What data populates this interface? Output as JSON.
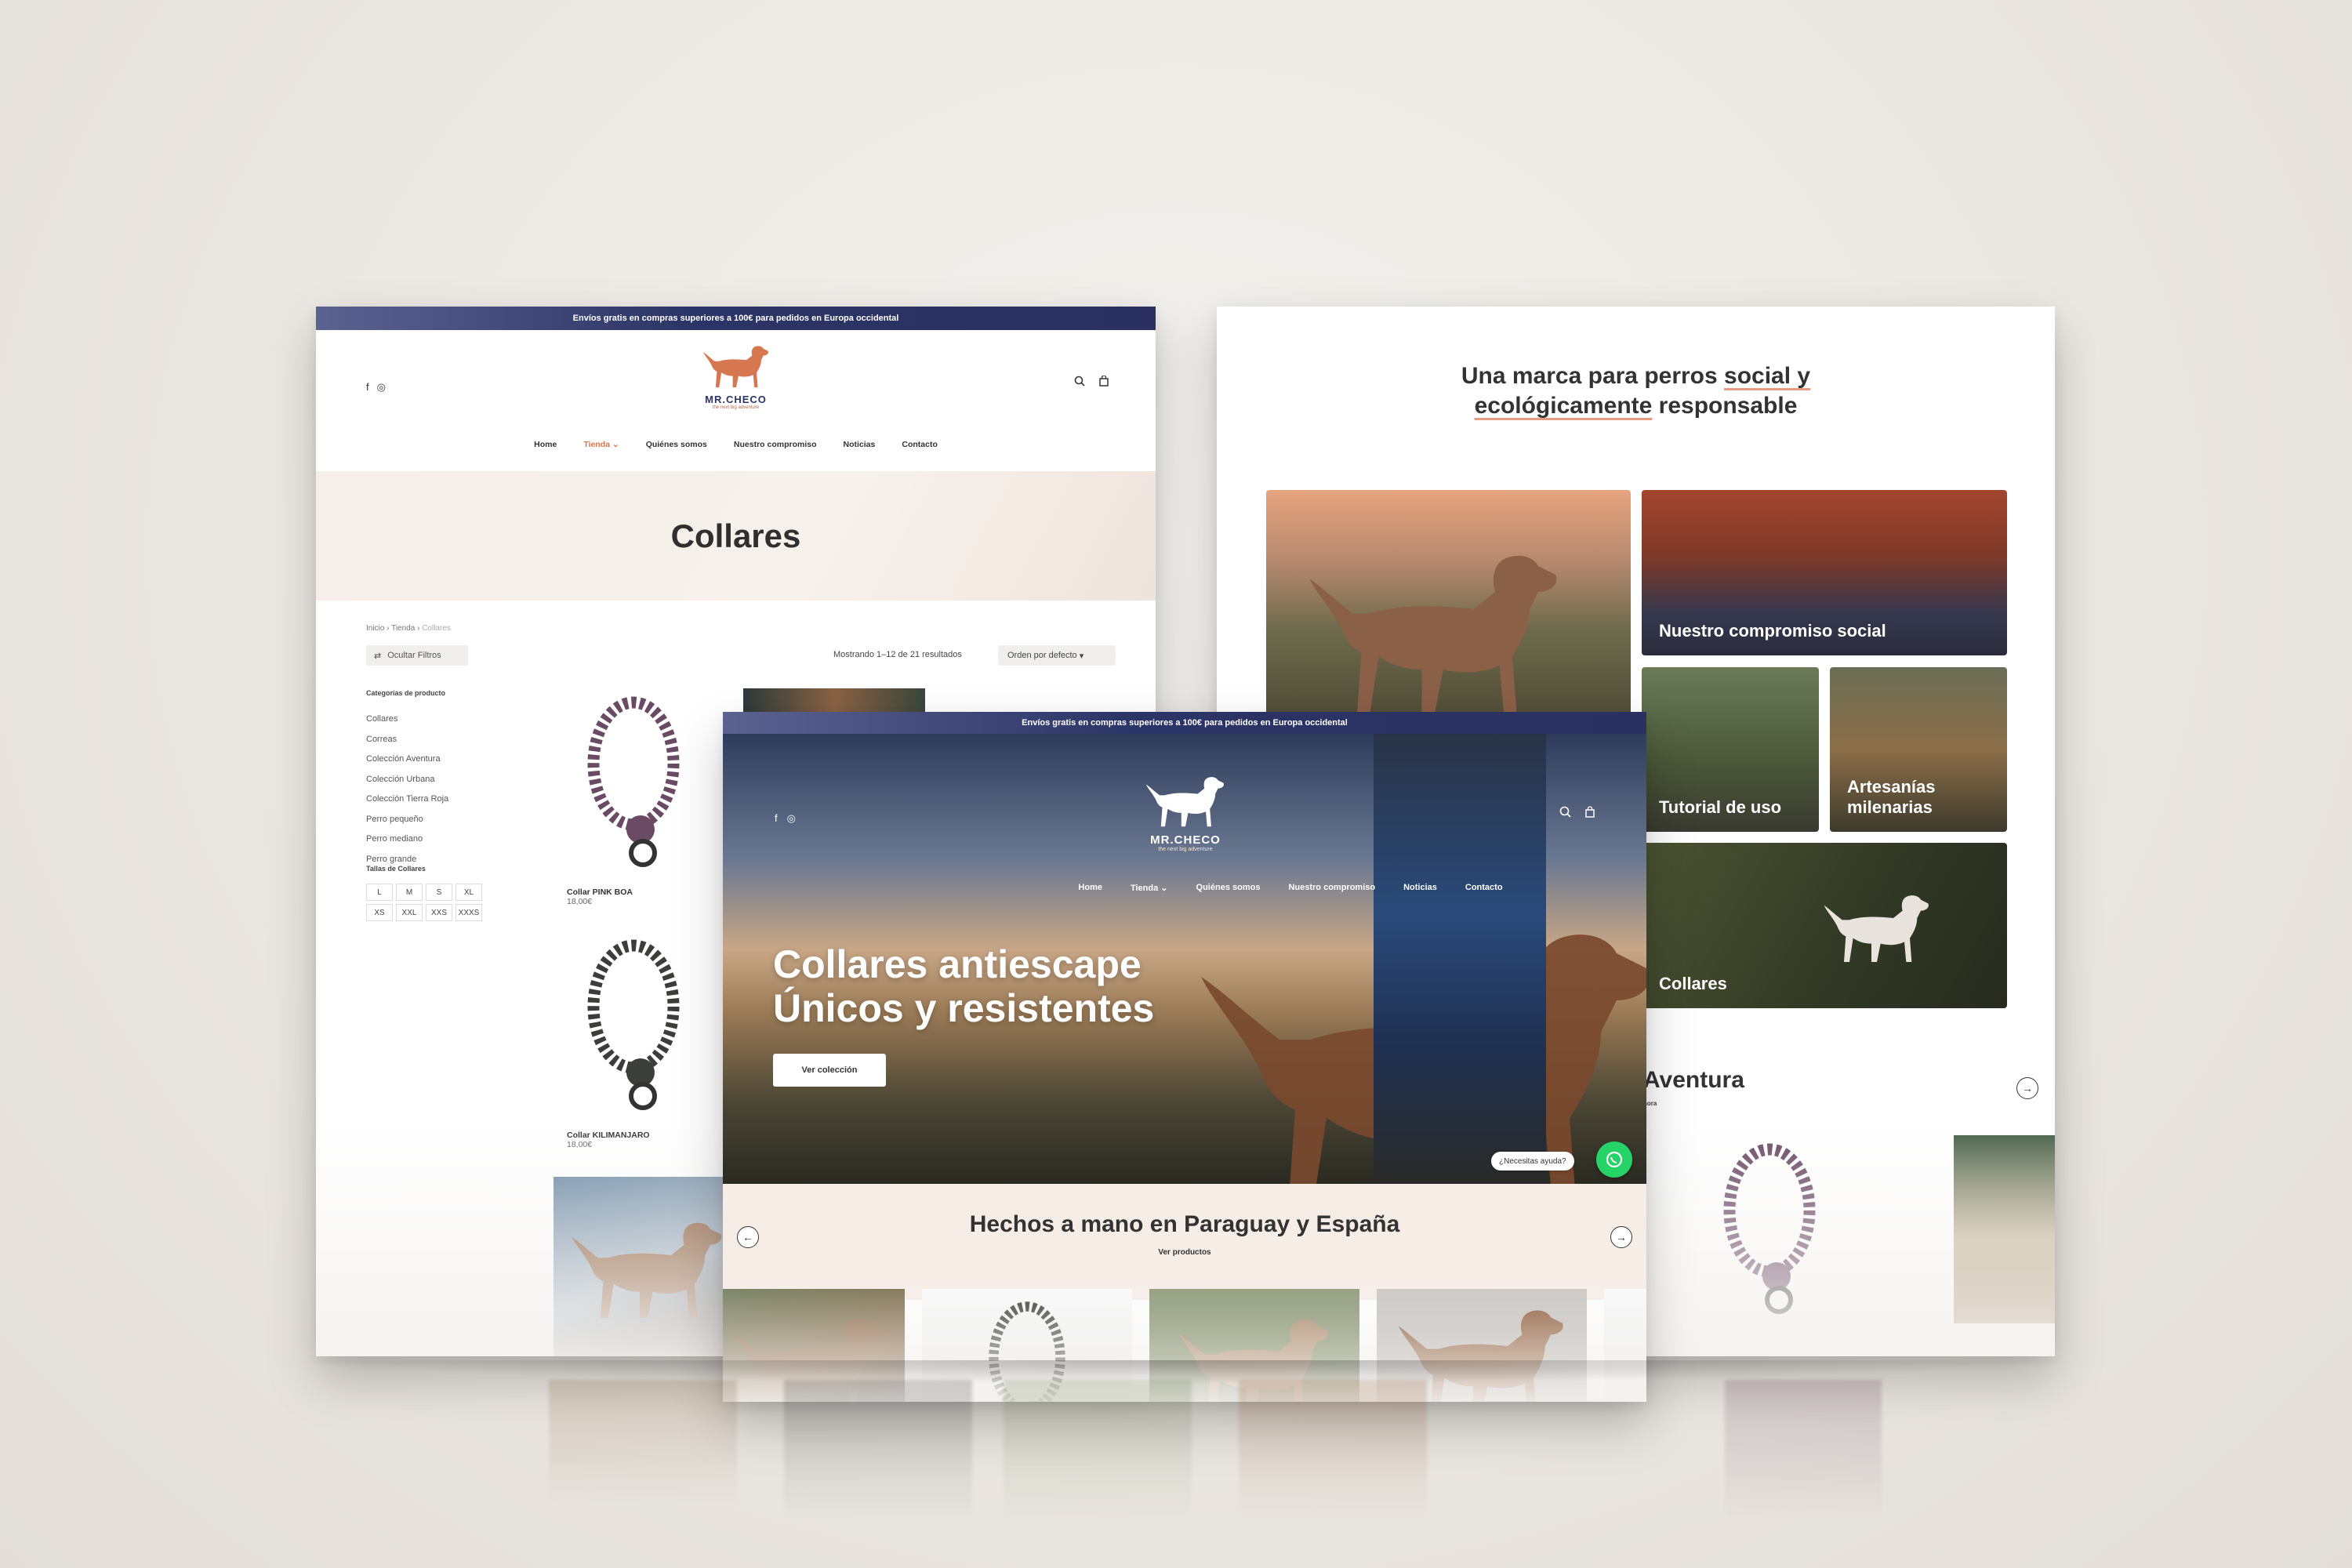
{
  "topbar": "Envíos gratis en compras superiores a 100€ para pedidos en Europa occidental",
  "brand": {
    "name": "MR.CHECO",
    "tagline": "the next big adventure"
  },
  "colors": {
    "accent": "#d6774f",
    "navy": "#2b3466",
    "whatsapp": "#25d366"
  },
  "nav": [
    "Home",
    "Tienda",
    "Quiénes somos",
    "Nuestro compromiso",
    "Noticias",
    "Contacto"
  ],
  "shop": {
    "title": "Collares",
    "breadcrumb": [
      "Inicio",
      "Tienda",
      "Collares"
    ],
    "filter_button": "Ocultar Filtros",
    "results": "Mostrando 1–12 de 21 resultados",
    "sort": "Orden por defecto",
    "categories_heading": "Categorías de producto",
    "categories": [
      "Collares",
      "Correas",
      "Colección Aventura",
      "Colección Urbana",
      "Colección Tierra Roja",
      "Perro pequeño",
      "Perro mediano",
      "Perro grande"
    ],
    "sizes_heading": "Tallas de Collares",
    "sizes": [
      "L",
      "M",
      "S",
      "XL",
      "XS",
      "XXL",
      "XXS",
      "XXXS"
    ],
    "products": [
      {
        "name": "Collar PINK BOA",
        "price": "18,00€"
      },
      {
        "name": "Collar KILIMANJARO",
        "price": "18,00€"
      }
    ]
  },
  "brand_page": {
    "title_part1": "Una marca para perros ",
    "title_ul1": "social y",
    "title_ul2": "ecológicamente",
    "title_part2": " responsable",
    "tiles": [
      "Nuestro compromiso social",
      "Tutorial de uso",
      "Artesanías milenarias",
      "Collares"
    ],
    "section": "Aventura",
    "section_sub": "hora"
  },
  "home": {
    "hero_line1": "Collares antiescape",
    "hero_line2": "Únicos y resistentes",
    "cta": "Ver colección",
    "help": "¿Necesitas ayuda?",
    "band_title": "Hechos a mano en Paraguay y España",
    "band_link": "Ver productos"
  }
}
